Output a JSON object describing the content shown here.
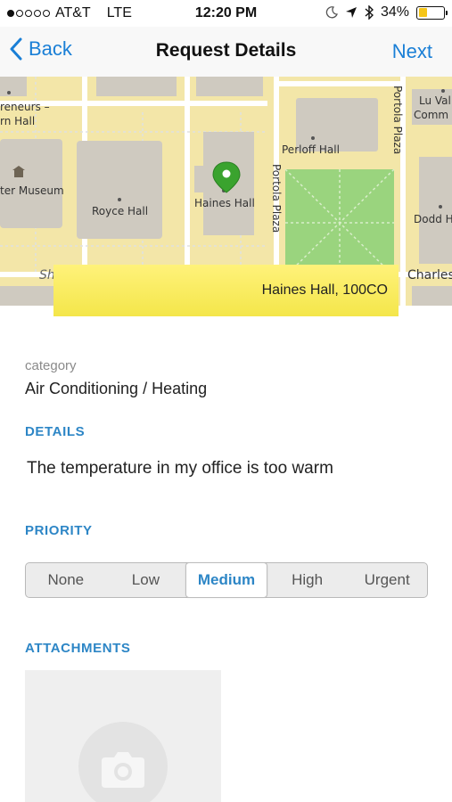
{
  "status_bar": {
    "carrier": "AT&T",
    "network": "LTE",
    "time": "12:20 PM",
    "battery": "34%",
    "battery_level": 0.34,
    "battery_color": "#f5c518",
    "icons": [
      "moon-icon",
      "location-arrow-icon",
      "bluetooth-icon"
    ]
  },
  "nav": {
    "back_label": "Back",
    "title": "Request Details",
    "next_label": "Next"
  },
  "map": {
    "labels": {
      "entrepreneurs": "reneurs –",
      "hall_left": "rn Hall",
      "museum": "ter Museum",
      "royce": "Royce Hall",
      "haines": "Haines Hall",
      "perloff": "Perloff Hall",
      "portola_vertical_1": "Portola Plaza",
      "portola_vertical_2": "Portola Plaza",
      "lu_valle_1": "Lu Val",
      "lu_valle_2": "Comm",
      "dodd": "Dodd H",
      "charles": "Charles",
      "sh": "Sh"
    },
    "location": "Haines Hall, 100CO"
  },
  "category": {
    "label": "category",
    "value": "Air Conditioning / Heating"
  },
  "details": {
    "header": "DETAILS",
    "text": "The temperature in my office is too warm"
  },
  "priority": {
    "header": "PRIORITY",
    "options": [
      "None",
      "Low",
      "Medium",
      "High",
      "Urgent"
    ],
    "selected": "Medium"
  },
  "attachments": {
    "header": "ATTACHMENTS"
  },
  "colors": {
    "accent": "#2d86c6",
    "nav_link": "#1a7fd6",
    "map_land": "#f3e6a8",
    "map_building": "#cfcac0",
    "map_park": "#9ad47e",
    "pin": "#3aa32e",
    "banner": "#f4e64a"
  }
}
